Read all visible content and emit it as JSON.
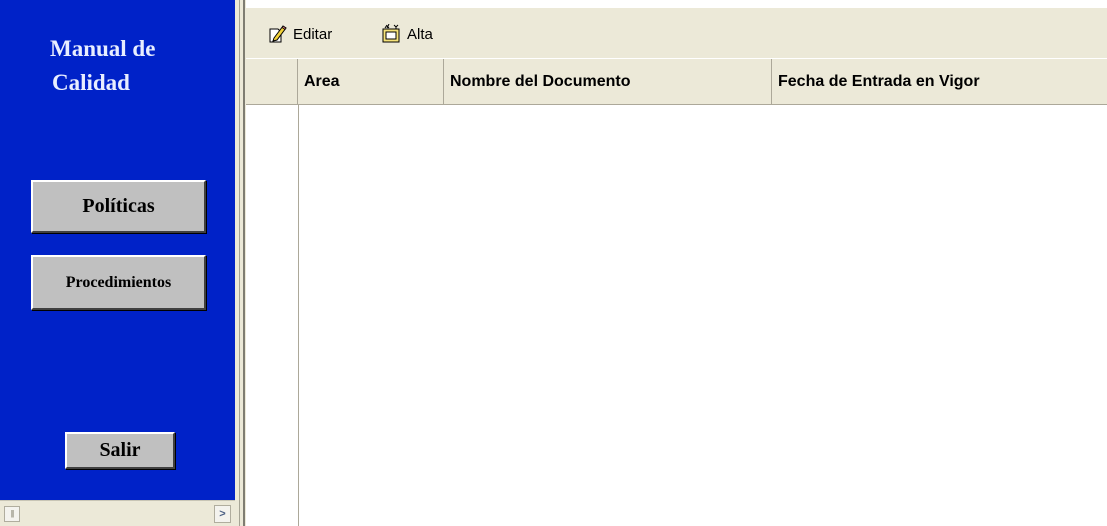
{
  "nav": {
    "title_line1": "Manual de",
    "title_line2": "Calidad",
    "buttons": {
      "politicas": "Políticas",
      "procedimientos": "Procedimientos",
      "salir": "Salir"
    },
    "colors": {
      "panel": "#0022c8",
      "title": "#e8eeff",
      "button": "#c0c0c0"
    }
  },
  "toolbar": {
    "edit_label": "Editar",
    "edit_icon": "edit-pencil-icon",
    "add_label": "Alta",
    "add_icon": "new-record-icon"
  },
  "grid": {
    "columns": [
      "Area",
      "Nombre del Documento",
      "Fecha de Entrada en Vigor"
    ],
    "rows": []
  },
  "scrollbar": {
    "thumb_icon": "grip-icon",
    "arrow_icon": "chevron-right-icon"
  }
}
